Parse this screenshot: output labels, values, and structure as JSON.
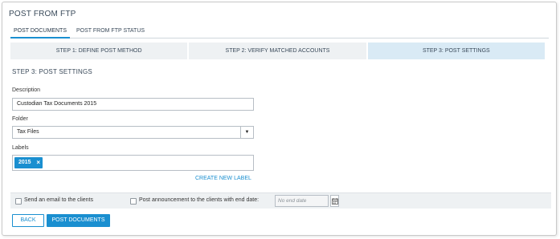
{
  "page": {
    "title": "POST FROM FTP"
  },
  "tabs": [
    {
      "label": "POST DOCUMENTS",
      "active": true
    },
    {
      "label": "POST FROM FTP STATUS",
      "active": false
    }
  ],
  "steps": [
    {
      "label": "STEP 1: DEFINE POST METHOD",
      "active": false
    },
    {
      "label": "STEP 2: VERIFY MATCHED ACCOUNTS",
      "active": false
    },
    {
      "label": "STEP 3: POST SETTINGS",
      "active": true
    }
  ],
  "section_title": "STEP 3: POST SETTINGS",
  "form": {
    "description_label": "Description",
    "description_value": "Custodian Tax Documents 2015",
    "folder_label": "Folder",
    "folder_value": "Tax Files",
    "labels_label": "Labels",
    "label_tags": [
      "2015"
    ],
    "create_label_link": "CREATE NEW LABEL"
  },
  "options": {
    "send_email_label": "Send an email to the clients",
    "send_email_checked": false,
    "post_announcement_label": "Post announcement to the clients with end date:",
    "post_announcement_checked": false,
    "end_date_placeholder": "No end date"
  },
  "actions": {
    "back_label": "BACK",
    "post_label": "POST DOCUMENTS"
  },
  "colors": {
    "accent": "#1a8fd0",
    "step_active_bg": "#d9eaf5",
    "step_bg": "#eef1f3"
  },
  "icons": {
    "tag_remove": "close-icon",
    "select": "chevron-down-icon",
    "date": "calendar-icon"
  }
}
